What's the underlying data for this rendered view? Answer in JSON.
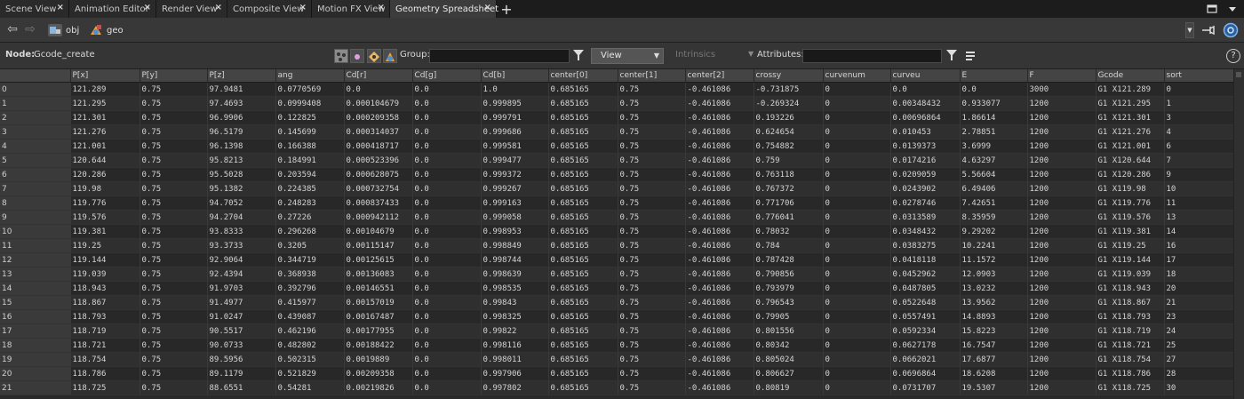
{
  "tabs": [
    {
      "label": "Scene View",
      "active": false
    },
    {
      "label": "Animation Editor",
      "active": false
    },
    {
      "label": "Render View",
      "active": false
    },
    {
      "label": "Composite View",
      "active": false
    },
    {
      "label": "Motion FX View",
      "active": false
    },
    {
      "label": "Geometry Spreadsheet",
      "active": true
    }
  ],
  "tab_close_glyph": "×",
  "tab_add_glyph": "+",
  "path": {
    "back_glyph": "⇦",
    "forward_glyph": "⇨",
    "obj": "obj",
    "geo": "geo"
  },
  "node_label": "Node:",
  "node_name": "Gcode_create",
  "group_label": "Group:",
  "view_label": "View",
  "intrinsics_label": "Intrinsics",
  "attributes_label": "Attributes:",
  "help_glyph": "?",
  "columns": [
    "",
    "P[x]",
    "P[y]",
    "P[z]",
    "ang",
    "Cd[r]",
    "Cd[g]",
    "Cd[b]",
    "center[0]",
    "center[1]",
    "center[2]",
    "crossy",
    "curvenum",
    "curveu",
    "E",
    "F",
    "Gcode",
    "sort"
  ],
  "rows": [
    [
      "0",
      "121.289",
      "0.75",
      "97.9481",
      "0.0770569",
      "0.0",
      "0.0",
      "1.0",
      "0.685165",
      "0.75",
      "-0.461086",
      "-0.731875",
      "0",
      "0.0",
      "0.0",
      "3000",
      "G1 X121.289",
      "0"
    ],
    [
      "1",
      "121.295",
      "0.75",
      "97.4693",
      "0.0999408",
      "0.000104679",
      "0.0",
      "0.999895",
      "0.685165",
      "0.75",
      "-0.461086",
      "-0.269324",
      "0",
      "0.00348432",
      "0.933077",
      "1200",
      "G1 X121.295",
      "1"
    ],
    [
      "2",
      "121.301",
      "0.75",
      "96.9906",
      "0.122825",
      "0.000209358",
      "0.0",
      "0.999791",
      "0.685165",
      "0.75",
      "-0.461086",
      "0.193226",
      "0",
      "0.00696864",
      "1.86614",
      "1200",
      "G1 X121.301",
      "3"
    ],
    [
      "3",
      "121.276",
      "0.75",
      "96.5179",
      "0.145699",
      "0.000314037",
      "0.0",
      "0.999686",
      "0.685165",
      "0.75",
      "-0.461086",
      "0.624654",
      "0",
      "0.010453",
      "2.78851",
      "1200",
      "G1 X121.276",
      "4"
    ],
    [
      "4",
      "121.001",
      "0.75",
      "96.1398",
      "0.166388",
      "0.000418717",
      "0.0",
      "0.999581",
      "0.685165",
      "0.75",
      "-0.461086",
      "0.754882",
      "0",
      "0.0139373",
      "3.6999",
      "1200",
      "G1 X121.001",
      "6"
    ],
    [
      "5",
      "120.644",
      "0.75",
      "95.8213",
      "0.184991",
      "0.000523396",
      "0.0",
      "0.999477",
      "0.685165",
      "0.75",
      "-0.461086",
      "0.759",
      "0",
      "0.0174216",
      "4.63297",
      "1200",
      "G1 X120.644",
      "7"
    ],
    [
      "6",
      "120.286",
      "0.75",
      "95.5028",
      "0.203594",
      "0.000628075",
      "0.0",
      "0.999372",
      "0.685165",
      "0.75",
      "-0.461086",
      "0.763118",
      "0",
      "0.0209059",
      "5.56604",
      "1200",
      "G1 X120.286",
      "9"
    ],
    [
      "7",
      "119.98",
      "0.75",
      "95.1382",
      "0.224385",
      "0.000732754",
      "0.0",
      "0.999267",
      "0.685165",
      "0.75",
      "-0.461086",
      "0.767372",
      "0",
      "0.0243902",
      "6.49406",
      "1200",
      "G1 X119.98",
      "10"
    ],
    [
      "8",
      "119.776",
      "0.75",
      "94.7052",
      "0.248283",
      "0.000837433",
      "0.0",
      "0.999163",
      "0.685165",
      "0.75",
      "-0.461086",
      "0.771706",
      "0",
      "0.0278746",
      "7.42651",
      "1200",
      "G1 X119.776",
      "11"
    ],
    [
      "9",
      "119.576",
      "0.75",
      "94.2704",
      "0.27226",
      "0.000942112",
      "0.0",
      "0.999058",
      "0.685165",
      "0.75",
      "-0.461086",
      "0.776041",
      "0",
      "0.0313589",
      "8.35959",
      "1200",
      "G1 X119.576",
      "13"
    ],
    [
      "10",
      "119.381",
      "0.75",
      "93.8333",
      "0.296268",
      "0.00104679",
      "0.0",
      "0.998953",
      "0.685165",
      "0.75",
      "-0.461086",
      "0.78032",
      "0",
      "0.0348432",
      "9.29202",
      "1200",
      "G1 X119.381",
      "14"
    ],
    [
      "11",
      "119.25",
      "0.75",
      "93.3733",
      "0.3205",
      "0.00115147",
      "0.0",
      "0.998849",
      "0.685165",
      "0.75",
      "-0.461086",
      "0.784",
      "0",
      "0.0383275",
      "10.2241",
      "1200",
      "G1 X119.25",
      "16"
    ],
    [
      "12",
      "119.144",
      "0.75",
      "92.9064",
      "0.344719",
      "0.00125615",
      "0.0",
      "0.998744",
      "0.685165",
      "0.75",
      "-0.461086",
      "0.787428",
      "0",
      "0.0418118",
      "11.1572",
      "1200",
      "G1 X119.144",
      "17"
    ],
    [
      "13",
      "119.039",
      "0.75",
      "92.4394",
      "0.368938",
      "0.00136083",
      "0.0",
      "0.998639",
      "0.685165",
      "0.75",
      "-0.461086",
      "0.790856",
      "0",
      "0.0452962",
      "12.0903",
      "1200",
      "G1 X119.039",
      "18"
    ],
    [
      "14",
      "118.943",
      "0.75",
      "91.9703",
      "0.392796",
      "0.00146551",
      "0.0",
      "0.998535",
      "0.685165",
      "0.75",
      "-0.461086",
      "0.793979",
      "0",
      "0.0487805",
      "13.0232",
      "1200",
      "G1 X118.943",
      "20"
    ],
    [
      "15",
      "118.867",
      "0.75",
      "91.4977",
      "0.415977",
      "0.00157019",
      "0.0",
      "0.99843",
      "0.685165",
      "0.75",
      "-0.461086",
      "0.796543",
      "0",
      "0.0522648",
      "13.9562",
      "1200",
      "G1 X118.867",
      "21"
    ],
    [
      "16",
      "118.793",
      "0.75",
      "91.0247",
      "0.439087",
      "0.00167487",
      "0.0",
      "0.998325",
      "0.685165",
      "0.75",
      "-0.461086",
      "0.79905",
      "0",
      "0.0557491",
      "14.8893",
      "1200",
      "G1 X118.793",
      "23"
    ],
    [
      "17",
      "118.719",
      "0.75",
      "90.5517",
      "0.462196",
      "0.00177955",
      "0.0",
      "0.99822",
      "0.685165",
      "0.75",
      "-0.461086",
      "0.801556",
      "0",
      "0.0592334",
      "15.8223",
      "1200",
      "G1 X118.719",
      "24"
    ],
    [
      "18",
      "118.721",
      "0.75",
      "90.0733",
      "0.482802",
      "0.00188422",
      "0.0",
      "0.998116",
      "0.685165",
      "0.75",
      "-0.461086",
      "0.80342",
      "0",
      "0.0627178",
      "16.7547",
      "1200",
      "G1 X118.721",
      "25"
    ],
    [
      "19",
      "118.754",
      "0.75",
      "89.5956",
      "0.502315",
      "0.0019889",
      "0.0",
      "0.998011",
      "0.685165",
      "0.75",
      "-0.461086",
      "0.805024",
      "0",
      "0.0662021",
      "17.6877",
      "1200",
      "G1 X118.754",
      "27"
    ],
    [
      "20",
      "118.786",
      "0.75",
      "89.1179",
      "0.521829",
      "0.00209358",
      "0.0",
      "0.997906",
      "0.685165",
      "0.75",
      "-0.461086",
      "0.806627",
      "0",
      "0.0696864",
      "18.6208",
      "1200",
      "G1 X118.786",
      "28"
    ],
    [
      "21",
      "118.725",
      "0.75",
      "88.6551",
      "0.54281",
      "0.00219826",
      "0.0",
      "0.997802",
      "0.685165",
      "0.75",
      "-0.461086",
      "0.80819",
      "0",
      "0.0731707",
      "19.5307",
      "1200",
      "G1 X118.725",
      "30"
    ]
  ]
}
